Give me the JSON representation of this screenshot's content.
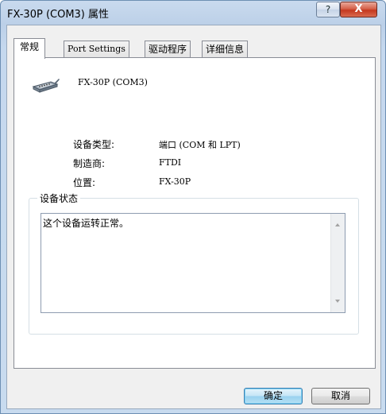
{
  "window": {
    "title": "FX-30P (COM3) 属性",
    "help_glyph": "?",
    "close_glyph": "X"
  },
  "tabs": [
    {
      "label": "常规",
      "active": true
    },
    {
      "label": "Port Settings",
      "active": false
    },
    {
      "label": "驱动程序",
      "active": false
    },
    {
      "label": "详细信息",
      "active": false
    }
  ],
  "general": {
    "device_name": "FX-30P (COM3)",
    "device_icon": "serial-port-icon",
    "properties": [
      {
        "label": "设备类型:",
        "value": "端口 (COM 和 LPT)"
      },
      {
        "label": "制造商:",
        "value": "FTDI"
      },
      {
        "label": "位置:",
        "value": "FX-30P"
      }
    ],
    "status_group_title": "设备状态",
    "status_text": "这个设备运转正常。"
  },
  "buttons": {
    "ok": "确定",
    "cancel": "取消"
  }
}
